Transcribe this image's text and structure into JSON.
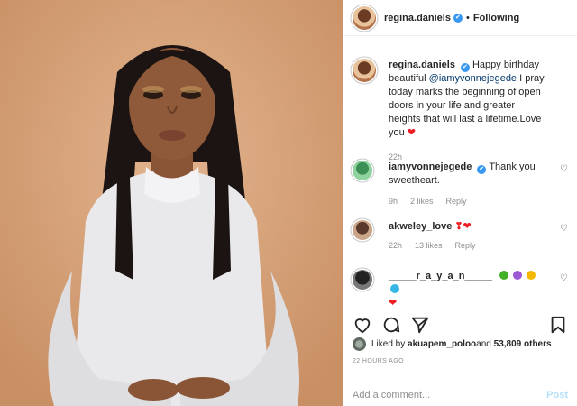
{
  "post": {
    "author": "regina.daniels",
    "separator": "•",
    "follow_status": "Following",
    "verified_mark": "✔"
  },
  "comments": [
    {
      "user": "regina.daniels",
      "text_prefix": "Happy birthday beautiful ",
      "mention": "@iamyvonnejegede",
      "text_suffix": " I pray today marks the beginning of open doors in your life and greater heights that will last a lifetime.Love you ",
      "emoji": "❤",
      "time": "22h"
    },
    {
      "user": "iamyvonnejegede",
      "text": "Thank you sweetheart.",
      "time": "9h",
      "likes": "2 likes",
      "reply": "Reply"
    },
    {
      "user": "akweley_love",
      "emoji": "❣❤",
      "time": "22h",
      "likes": "13 likes",
      "reply": "Reply"
    },
    {
      "user": "_____r_a_y_a_n_____",
      "emoji": "❤",
      "heart_colors": [
        "#43b02a",
        "#9b59d6",
        "#f5b800",
        "#35b6e6"
      ]
    }
  ],
  "likes": {
    "prefix": "Liked by ",
    "user": "akuapem_poloo",
    "middle": " and ",
    "count": "53,809 others"
  },
  "timestamp": "22 HOURS AGO",
  "add_comment": {
    "placeholder": "Add a comment...",
    "post_label": "Post"
  },
  "icons": {
    "like": "heart-icon",
    "comment": "comment-icon",
    "share": "share-icon",
    "save": "bookmark-icon",
    "comment_like": "small-heart-icon"
  },
  "colors": {
    "accent": "#3897f0",
    "heart_red": "#ed1c24",
    "background_photo": "#d8a47c"
  }
}
